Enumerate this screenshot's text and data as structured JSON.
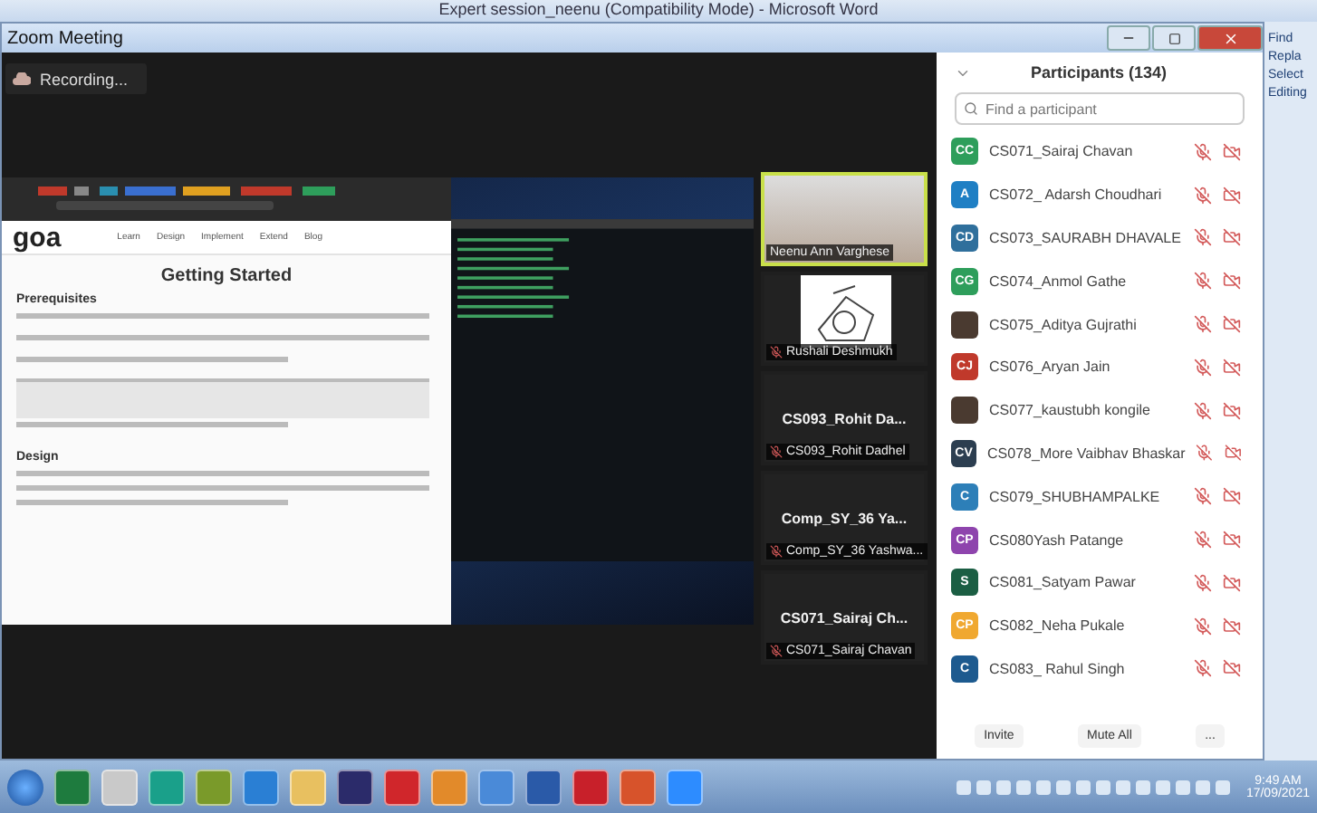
{
  "word_window": {
    "title": "Expert session_neenu (Compatibility Mode) - Microsoft Word",
    "ribbon": [
      "Find",
      "Repla",
      "Select",
      "Editing"
    ]
  },
  "zoom_window": {
    "title": "Zoom Meeting",
    "recording": "Recording..."
  },
  "shared_screen": {
    "logo": "goa",
    "nav": [
      "Learn",
      "Design",
      "Implement",
      "Extend",
      "Blog"
    ],
    "heading": "Getting Started",
    "sections": [
      "Prerequisites",
      "Design"
    ]
  },
  "video_tiles": [
    {
      "kind": "video",
      "label": "Neenu Ann Varghese",
      "active": true,
      "muted": false
    },
    {
      "kind": "picture",
      "label": "Rushali Deshmukh",
      "active": false,
      "muted": true
    },
    {
      "kind": "name",
      "display": "CS093_Rohit  Da...",
      "label": "CS093_Rohit Dadhel",
      "active": false,
      "muted": true
    },
    {
      "kind": "name",
      "display": "Comp_SY_36  Ya...",
      "label": "Comp_SY_36 Yashwa...",
      "active": false,
      "muted": true
    },
    {
      "kind": "name",
      "display": "CS071_Sairaj  Ch...",
      "label": "CS071_Sairaj Chavan",
      "active": false,
      "muted": true
    }
  ],
  "participants": {
    "title": "Participants (134)",
    "search_placeholder": "Find a participant",
    "items": [
      {
        "kind": "initials",
        "initials": "CC",
        "color": "#2e9e5b",
        "name": "CS071_Sairaj Chavan",
        "muted": true,
        "video_off": true
      },
      {
        "kind": "initials",
        "initials": "A",
        "color": "#1f7fc4",
        "name": "CS072_ Adarsh Choudhari",
        "muted": true,
        "video_off": true
      },
      {
        "kind": "initials",
        "initials": "CD",
        "color": "#2f6f9c",
        "name": "CS073_SAURABH DHAVALE",
        "muted": true,
        "video_off": true
      },
      {
        "kind": "initials",
        "initials": "CG",
        "color": "#2e9e5b",
        "name": "CS074_Anmol Gathe",
        "muted": true,
        "video_off": true
      },
      {
        "kind": "photo",
        "name": "CS075_Aditya Gujrathi",
        "muted": true,
        "video_off": true
      },
      {
        "kind": "initials",
        "initials": "CJ",
        "color": "#c0392b",
        "name": "CS076_Aryan Jain",
        "muted": true,
        "video_off": true
      },
      {
        "kind": "photo",
        "name": "CS077_kaustubh kongile",
        "muted": true,
        "video_off": true
      },
      {
        "kind": "initials",
        "initials": "CV",
        "color": "#2c3e50",
        "name": "CS078_More Vaibhav Bhaskar",
        "muted": true,
        "video_off": true
      },
      {
        "kind": "initials",
        "initials": "C",
        "color": "#2d7fb8",
        "name": "CS079_SHUBHAMPALKE",
        "muted": true,
        "video_off": true
      },
      {
        "kind": "initials",
        "initials": "CP",
        "color": "#8e44ad",
        "name": "CS080Yash Patange",
        "muted": true,
        "video_off": true
      },
      {
        "kind": "initials",
        "initials": "S",
        "color": "#1b5e43",
        "name": "CS081_Satyam Pawar",
        "muted": true,
        "video_off": true
      },
      {
        "kind": "initials",
        "initials": "CP",
        "color": "#f0a830",
        "name": "CS082_Neha Pukale",
        "muted": true,
        "video_off": true
      },
      {
        "kind": "initials",
        "initials": "C",
        "color": "#1d5a8f",
        "name": "CS083_ Rahul Singh",
        "muted": true,
        "video_off": true
      }
    ],
    "buttons": [
      "Invite",
      "Mute All",
      "..."
    ]
  },
  "taskbar": {
    "time": "9:49 AM",
    "date": "17/09/2021"
  }
}
